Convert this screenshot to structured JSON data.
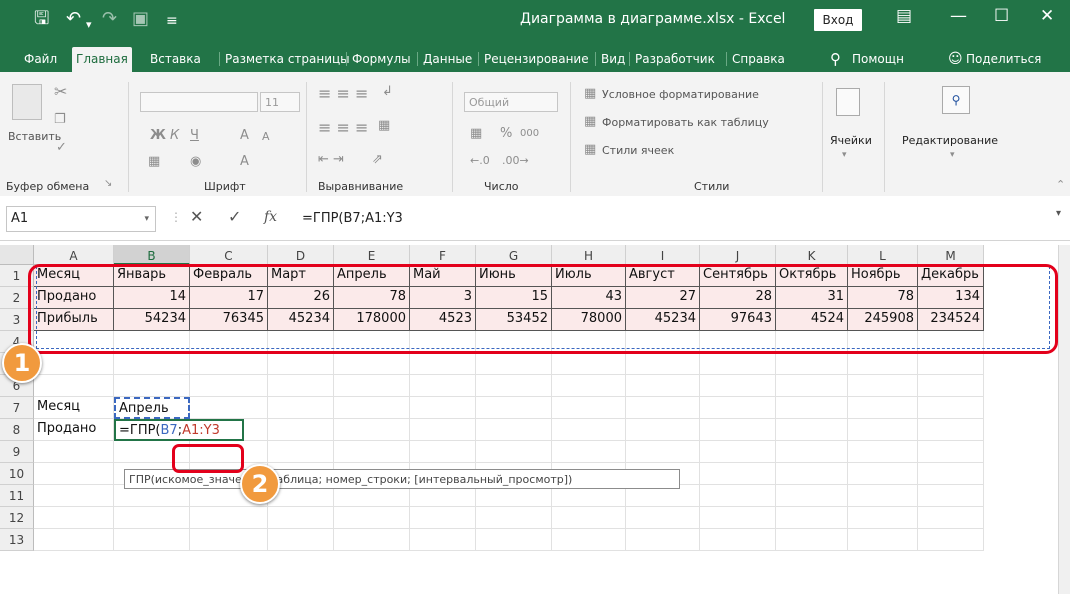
{
  "window": {
    "title": "Диаграмма в диаграмме.xlsx  -  Excel",
    "login": "Вход",
    "icons": [
      "save-icon",
      "undo-icon",
      "redo-icon",
      "camera-icon",
      "customize-icon",
      "ribbon-display-icon",
      "minimize-icon",
      "maximize-icon",
      "close-icon"
    ]
  },
  "menu": {
    "tabs": [
      "Файл",
      "Главная",
      "Вставка",
      "Разметка страницы",
      "Формулы",
      "Данные",
      "Рецензирование",
      "Вид",
      "Разработчик",
      "Справка"
    ],
    "active": "Главная",
    "help": "Помощн",
    "share": "Поделиться"
  },
  "ribbon": {
    "clipboard": {
      "paste": "Вставить",
      "label": "Буфер обмена"
    },
    "font": {
      "size": "11",
      "bold": "Ж",
      "italic": "К",
      "underline": "Ч",
      "grow": "A",
      "shrink": "A",
      "color": "A",
      "label": "Шрифт"
    },
    "align": {
      "label": "Выравнивание"
    },
    "number": {
      "format": "Общий",
      "percent": "%",
      "thousands": "000",
      "label": "Число"
    },
    "styles": {
      "conditional": "Условное форматирование",
      "as_table": "Форматировать как таблицу",
      "cell_styles": "Стили ячеек",
      "label": "Стили"
    },
    "cells": {
      "label": "Ячейки"
    },
    "editing": {
      "label": "Редактирование"
    }
  },
  "formula_bar": {
    "name_box": "A1",
    "fx": "fx",
    "formula": "=ГПР(B7;A1:Y3"
  },
  "sheet": {
    "columns": [
      "A",
      "B",
      "C",
      "D",
      "E",
      "F",
      "G",
      "H",
      "I",
      "J",
      "K",
      "L",
      "M"
    ],
    "rows": [
      "1",
      "2",
      "3",
      "4",
      "5",
      "6",
      "7",
      "8",
      "9",
      "10",
      "11",
      "12",
      "13"
    ],
    "table": {
      "months": [
        "Месяц",
        "Январь",
        "Февраль",
        "Март",
        "Апрель",
        "Май",
        "Июнь",
        "Июль",
        "Август",
        "Сентябрь",
        "Октябрь",
        "Ноябрь",
        "Декабрь"
      ],
      "sold": [
        "Продано",
        "14",
        "17",
        "26",
        "78",
        "3",
        "15",
        "43",
        "27",
        "28",
        "31",
        "78",
        "134"
      ],
      "profit": [
        "Прибыль",
        "54234",
        "76345",
        "45234",
        "178000",
        "4523",
        "53452",
        "78000",
        "45234",
        "97643",
        "4524",
        "245908",
        "234524"
      ]
    },
    "lookup": {
      "a7": "Месяц",
      "b7": "Апрель",
      "a8": "Продано",
      "b8_prefix": "=ГПР(",
      "b8_ref1": "B7",
      "b8_sep": ";",
      "b8_ref2": "A1:Y3"
    },
    "tooltip": "ГПР(искомое_значение; таблица; номер_строки; [интервальный_просмотр])"
  },
  "annotations": {
    "badge1": "1",
    "badge2": "2"
  },
  "colors": {
    "excel_green": "#227447",
    "highlight_red": "#e3001b",
    "badge_orange": "#f19a3e",
    "ref_blue": "#3b68c0",
    "ref_red": "#c0392b"
  }
}
